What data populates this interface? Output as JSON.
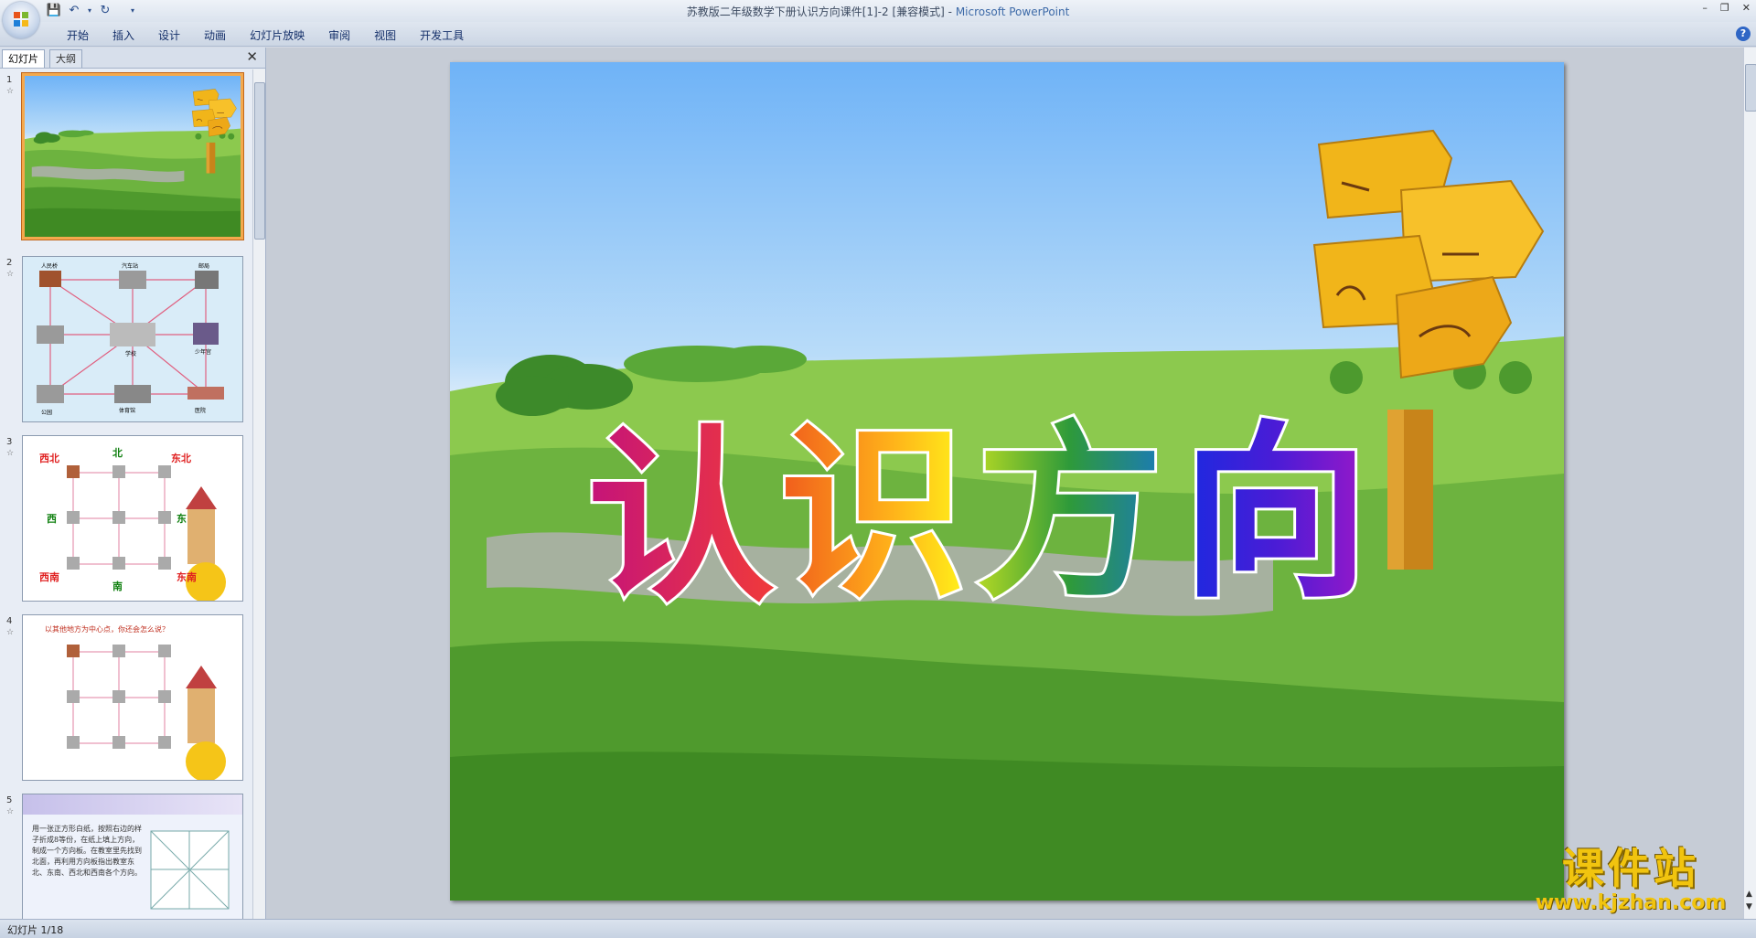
{
  "window": {
    "title": "苏教版二年级数学下册认识方向课件[1]-2 [兼容模式]",
    "app_name": "Microsoft PowerPoint",
    "separator": " - "
  },
  "ribbon": {
    "tabs": [
      "开始",
      "插入",
      "设计",
      "动画",
      "幻灯片放映",
      "审阅",
      "视图",
      "开发工具"
    ]
  },
  "slide_panel": {
    "tab_slides": "幻灯片",
    "tab_outline": "大纲",
    "thumbnails": [
      {
        "number": "1"
      },
      {
        "number": "2"
      },
      {
        "number": "3"
      },
      {
        "number": "4"
      },
      {
        "number": "5"
      }
    ]
  },
  "thumb2": {
    "labels": [
      "人民桥",
      "汽车站",
      "邮局",
      "少年宫",
      "体育馆",
      "学校",
      "医院",
      "公园"
    ]
  },
  "thumb3": {
    "nw": "西北",
    "n": "北",
    "ne": "东北",
    "w": "西",
    "e": "东",
    "sw": "西南",
    "s": "南",
    "se": "东南"
  },
  "thumb4": {
    "title": "以其他地方为中心点，你还会怎么说？"
  },
  "thumb5": {
    "text": "用一张正方形白纸，按照右边的样子折成8等份，在纸上填上方向，制成一个方向板。在教室里先找到北面，再利用方向板指出教室东北、东南、西北和西南各个方向。"
  },
  "slide": {
    "title_chars": [
      "认",
      "识",
      "方",
      "向"
    ]
  },
  "watermark": {
    "main": "课件站",
    "url": "www.kjzhan.com"
  },
  "status_bar": {
    "slide_info": "幻灯片 1/18"
  }
}
